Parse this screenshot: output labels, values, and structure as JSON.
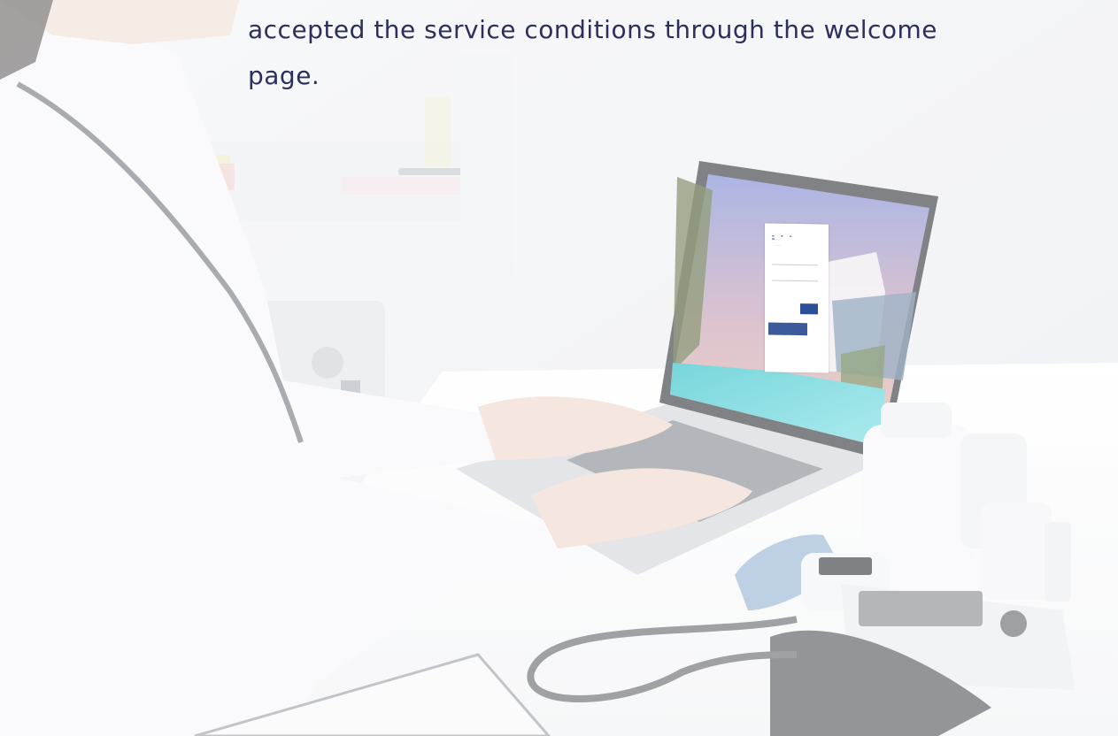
{
  "caption": {
    "line1": "accepted the service conditions through the welcome",
    "line2": "page."
  },
  "colors": {
    "caption_text": "#2c2f5c",
    "accent_blue": "#2d4f9a",
    "facebook_blue": "#3c5a9a",
    "pool_turquoise": "#3fd0d0"
  },
  "photo": {
    "subject": "doctor-using-laptop"
  }
}
